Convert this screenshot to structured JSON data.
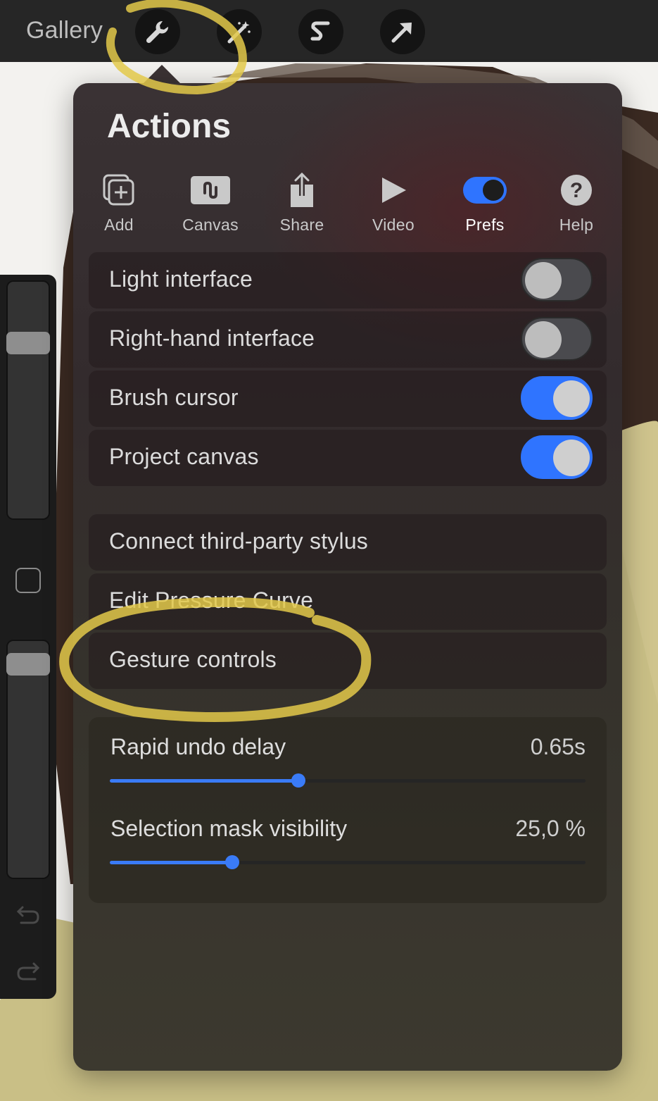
{
  "topbar": {
    "gallery_label": "Gallery",
    "tools": [
      {
        "name": "actions",
        "icon": "wrench-icon"
      },
      {
        "name": "adjustments",
        "icon": "magic-wand-icon"
      },
      {
        "name": "selection",
        "icon": "selection-s-icon"
      },
      {
        "name": "transform",
        "icon": "arrow-icon"
      }
    ]
  },
  "actions_panel": {
    "title": "Actions",
    "tabs": [
      {
        "label": "Add",
        "icon": "add-layer-icon",
        "active": false
      },
      {
        "label": "Canvas",
        "icon": "canvas-icon",
        "active": false
      },
      {
        "label": "Share",
        "icon": "share-icon",
        "active": false
      },
      {
        "label": "Video",
        "icon": "play-icon",
        "active": false
      },
      {
        "label": "Prefs",
        "icon": "toggle-icon",
        "active": true
      },
      {
        "label": "Help",
        "icon": "help-icon",
        "active": false
      }
    ],
    "toggles": [
      {
        "label": "Light interface",
        "on": false
      },
      {
        "label": "Right-hand interface",
        "on": false
      },
      {
        "label": "Brush cursor",
        "on": true
      },
      {
        "label": "Project canvas",
        "on": true
      }
    ],
    "links": [
      {
        "label": "Connect third-party stylus"
      },
      {
        "label": "Edit Pressure Curve"
      },
      {
        "label": "Gesture controls"
      }
    ],
    "sliders": [
      {
        "label": "Rapid undo delay",
        "value": "0.65s",
        "fraction": 0.397
      },
      {
        "label": "Selection mask visibility",
        "value": "25,0 %",
        "fraction": 0.258
      }
    ]
  },
  "sidebar": {
    "brush_size_fraction": 0.77,
    "opacity_fraction": 0.95,
    "icons": [
      "modify-square-icon",
      "undo-icon",
      "redo-icon"
    ]
  },
  "colors": {
    "accent_blue": "#2f74ff",
    "annotation_yellow": "#e3c94a",
    "canvas_brown": "#3a2a22",
    "canvas_khaki": "#c9bf86"
  }
}
